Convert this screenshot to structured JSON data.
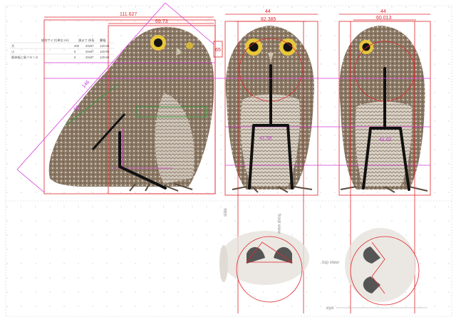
{
  "dimensions": {
    "side_total_width": "111.627",
    "side_head_width": "69.73",
    "side_diagonal_length": "146",
    "side_wing_length": "55",
    "side_small_label": "65",
    "front_width": "44",
    "front_body_width": "82.385",
    "back_width": "44",
    "back_body_width": "60.013",
    "front_hip_label": "41.56",
    "back_hip_label": "41.02"
  },
  "table": {
    "rows": [
      [
        "総合サイズ(単位:cm)",
        "頭まで",
        "体長",
        "翼幅"
      ],
      [
        "大",
        "200",
        "20x87",
        "120-80"
      ],
      [
        "小",
        "6",
        "20x87",
        "120-80"
      ],
      [
        "胴体幅と尾バランス",
        "6",
        "20x87",
        "120-80"
      ]
    ]
  },
  "labels": {
    "side_label": "side",
    "front_view_label": "front view",
    "top_view_label": "top view",
    "eye_label": "eye"
  },
  "colors": {
    "dimension_red": "#e0262b",
    "guide_magenta": "#d63ad9",
    "measure_green": "#2d9a3a",
    "skeleton_black": "#111111"
  }
}
